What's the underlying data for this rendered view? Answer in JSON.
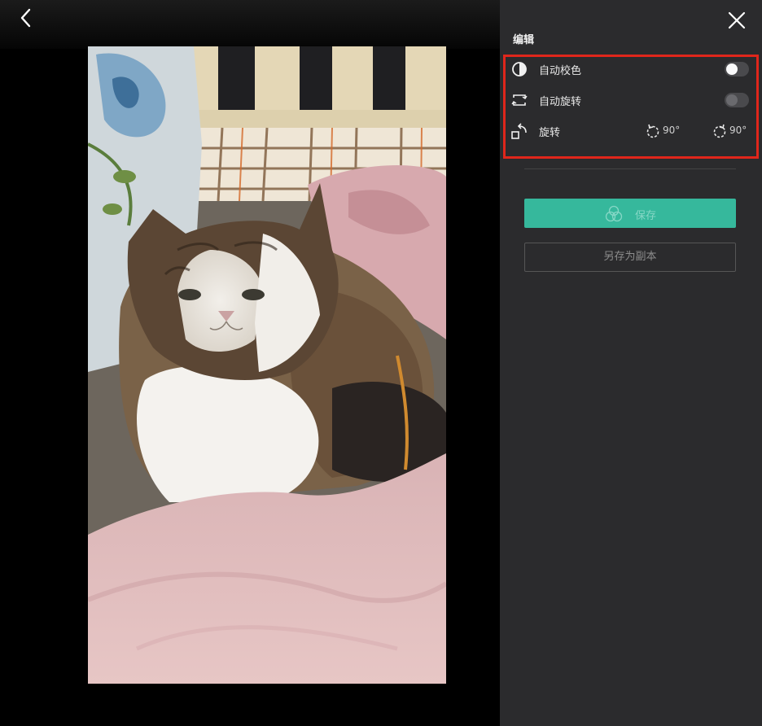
{
  "panel": {
    "title": "编辑",
    "auto_color_label": "自动校色",
    "auto_rotate_label": "自动旋转",
    "rotate_label": "旋转",
    "rotate_left_value": "90°",
    "rotate_right_value": "90°",
    "save_label": "保存",
    "save_as_label": "另存为副本"
  },
  "icons": {
    "back": "chevron-left-icon",
    "close": "close-icon",
    "auto_color": "contrast-icon",
    "auto_rotate": "auto-rotate-icon",
    "rotate": "rotate-icon",
    "rotate_left": "rotate-left-icon",
    "rotate_right": "rotate-right-icon",
    "save": "save-icon"
  },
  "colors": {
    "accent": "#36b89c",
    "highlight": "#e0261b",
    "panel_bg": "#2b2b2d"
  },
  "toggles": {
    "auto_color_on": false,
    "auto_rotate_on": false
  }
}
